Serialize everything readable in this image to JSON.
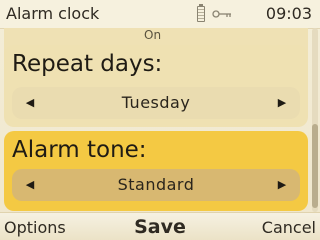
{
  "status_bar": {
    "title": "Alarm clock",
    "time": "09:03",
    "battery_icon": "battery-icon",
    "key_icon": "key-icon"
  },
  "previous_field": {
    "value_partial": "On"
  },
  "repeat_days": {
    "label": "Repeat days:",
    "value": "Tuesday",
    "left_arrow": "◀",
    "right_arrow": "▶"
  },
  "alarm_tone": {
    "label": "Alarm tone:",
    "value": "Standard",
    "left_arrow": "◀",
    "right_arrow": "▶",
    "highlight_color": "#f4c943"
  },
  "softkeys": {
    "left": "Options",
    "center": "Save",
    "right": "Cancel"
  }
}
